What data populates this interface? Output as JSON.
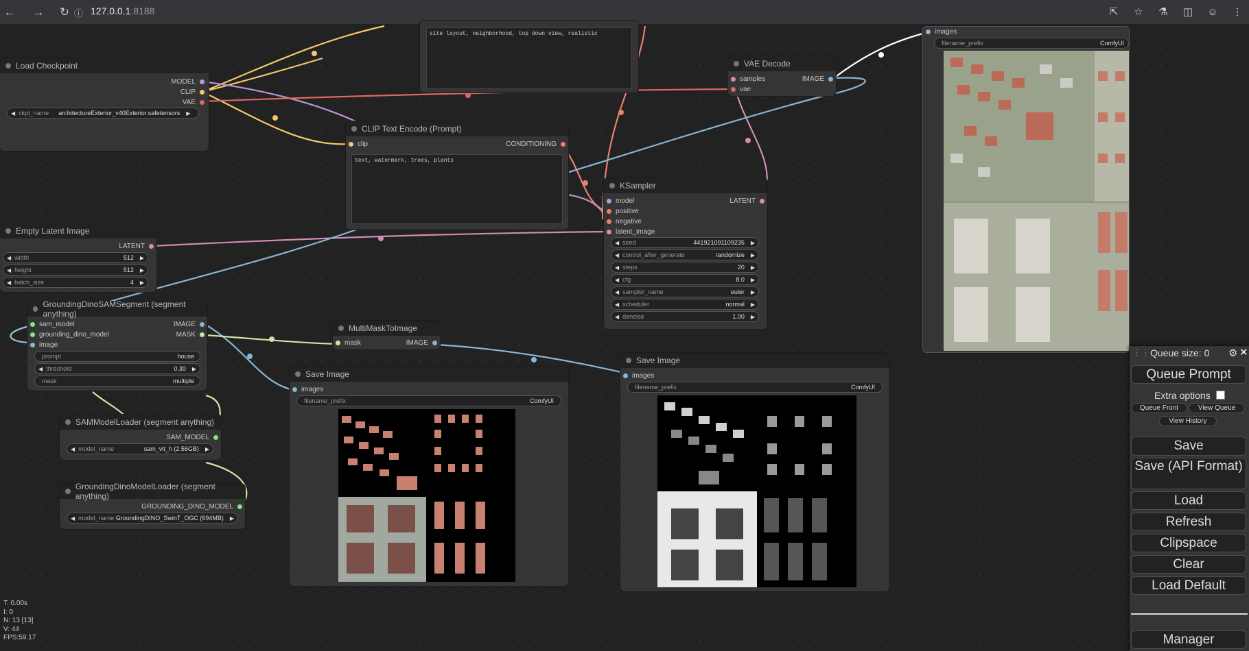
{
  "browser": {
    "url_host": "127.0.0.1",
    "url_port": ":8188"
  },
  "nodes": {
    "prompt_text": {
      "text": "site layout, neighborhood, top down view, realistic"
    },
    "load_checkpoint": {
      "title": "Load Checkpoint",
      "outputs": [
        "MODEL",
        "CLIP",
        "VAE"
      ],
      "ckpt_label": "ckpt_name",
      "ckpt_value": "architectureExterior_v40Exterior.safetensors"
    },
    "clip_text_encode": {
      "title": "CLIP Text Encode (Prompt)",
      "input": "clip",
      "output": "CONDITIONING",
      "text": "text, watermark, trees, plants"
    },
    "vae_decode": {
      "title": "VAE Decode",
      "inputs": [
        "samples",
        "vae"
      ],
      "output": "IMAGE"
    },
    "ksampler": {
      "title": "KSampler",
      "inputs": [
        "model",
        "positive",
        "negative",
        "latent_image"
      ],
      "output": "LATENT",
      "widgets": [
        {
          "name": "seed",
          "value": "441921091109235"
        },
        {
          "name": "control_after_generate",
          "value": "randomize"
        },
        {
          "name": "steps",
          "value": "20"
        },
        {
          "name": "cfg",
          "value": "8.0"
        },
        {
          "name": "sampler_name",
          "value": "euler"
        },
        {
          "name": "scheduler",
          "value": "normal"
        },
        {
          "name": "denoise",
          "value": "1.00"
        }
      ]
    },
    "empty_latent": {
      "title": "Empty Latent Image",
      "output": "LATENT",
      "widgets": [
        {
          "name": "width",
          "value": "512"
        },
        {
          "name": "height",
          "value": "512"
        },
        {
          "name": "batch_size",
          "value": "4"
        }
      ]
    },
    "grounding_sam": {
      "title": "GroundingDinoSAMSegment (segment anything)",
      "inputs": [
        "sam_model",
        "grounding_dino_model",
        "image"
      ],
      "outputs": [
        "IMAGE",
        "MASK"
      ],
      "widgets": [
        {
          "name": "prompt",
          "value": "house"
        },
        {
          "name": "threshold",
          "value": "0.30"
        },
        {
          "name": "mask",
          "value": "multiple"
        }
      ]
    },
    "multimask": {
      "title": "MultiMaskToImage",
      "input": "mask",
      "output": "IMAGE"
    },
    "save_image_1": {
      "title": "Save Image",
      "input": "images",
      "prefix_label": "filename_prefix",
      "prefix_value": "ComfyUI"
    },
    "save_image_2": {
      "title": "Save Image",
      "input": "images",
      "prefix_label": "filename_prefix",
      "prefix_value": "ComfyUI"
    },
    "preview_top": {
      "input": "images",
      "prefix_label": "filename_prefix",
      "prefix_value": "ComfyUI"
    },
    "sam_loader": {
      "title": "SAMModelLoader (segment anything)",
      "output": "SAM_MODEL",
      "widget_name": "model_name",
      "widget_value": "sam_vit_h (2.56GB)"
    },
    "gdino_loader": {
      "title": "GroundingDinoModelLoader (segment anything)",
      "output": "GROUNDING_DINO_MODEL",
      "widget_name": "model_name",
      "widget_value": "GroundingDINO_SwinT_OGC (694MB)"
    }
  },
  "menu": {
    "queue_size": "Queue size: 0",
    "queue_prompt": "Queue Prompt",
    "extra_options": "Extra options",
    "queue_front": "Queue Front",
    "view_queue": "View Queue",
    "view_history": "View History",
    "save": "Save",
    "save_api": "Save (API Format)",
    "load": "Load",
    "refresh": "Refresh",
    "clipspace": "Clipspace",
    "clear": "Clear",
    "load_default": "Load Default",
    "manager": "Manager"
  },
  "stats": {
    "t": "T: 0.00s",
    "i": "I: 0",
    "n": "N: 13 [13]",
    "v": "V: 44",
    "fps": "FPS:59.17"
  }
}
